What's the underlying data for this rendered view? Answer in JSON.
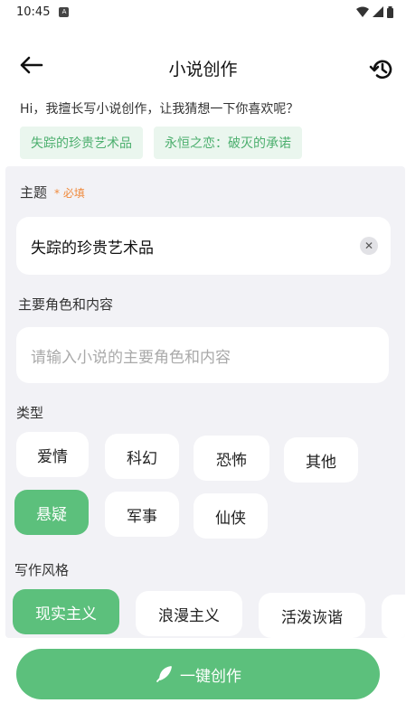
{
  "status_bar": {
    "time": "10:45",
    "notif_glyph": "A"
  },
  "header": {
    "title": "小说创作"
  },
  "intro": {
    "text": "Hi，我擅长写小说创作，让我猜想一下你喜欢呢？"
  },
  "suggestions": [
    "失踪的珍贵艺术品",
    "永恒之恋：破灭的承诺"
  ],
  "theme": {
    "label": "主题",
    "required": "* 必填",
    "value": "失踪的珍贵艺术品",
    "clear_glyph": "✕"
  },
  "characters": {
    "label": "主要角色和内容",
    "placeholder": "请输入小说的主要角色和内容"
  },
  "genre": {
    "label": "类型",
    "options": [
      "爱情",
      "科幻",
      "恐怖",
      "其他",
      "悬疑",
      "军事",
      "仙侠"
    ],
    "selected": "悬疑"
  },
  "style": {
    "label": "写作风格",
    "options": [
      "现实主义",
      "浪漫主义",
      "活泼诙谐"
    ],
    "selected": "现实主义"
  },
  "action": {
    "label": "一键创作"
  },
  "colors": {
    "accent": "#5cc07c",
    "chip_bg": "#eaf6ee",
    "required": "#f08a3c",
    "panel": "#f2f2f6"
  }
}
